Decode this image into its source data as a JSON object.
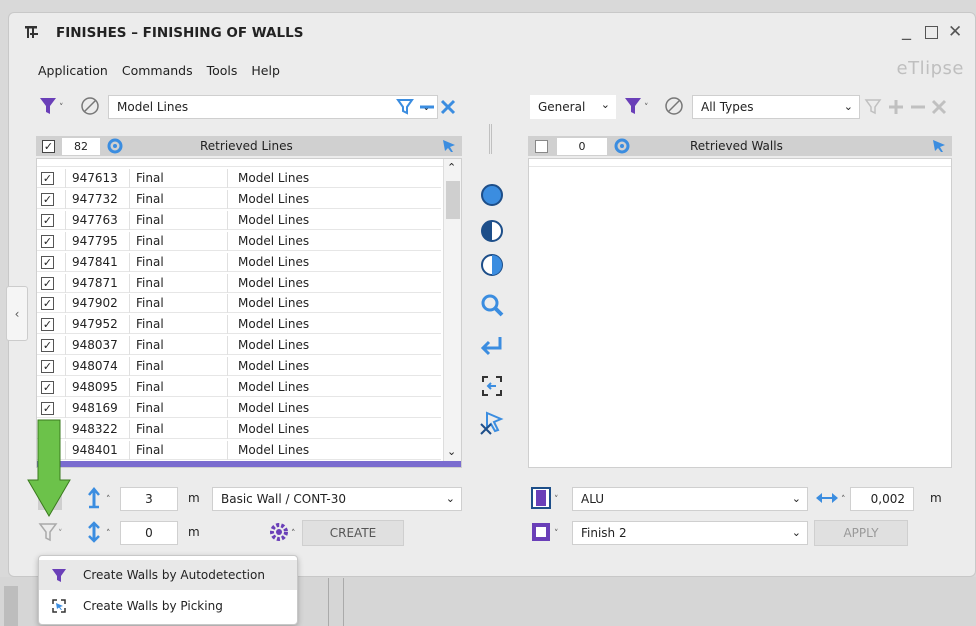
{
  "window": {
    "title": "FINISHES – FINISHING OF WALLS",
    "brand": "eTlipse"
  },
  "menu": [
    "Application",
    "Commands",
    "Tools",
    "Help"
  ],
  "left": {
    "category": "Model Lines",
    "count": "82",
    "header": "Retrieved Lines",
    "rows": [
      {
        "id": "947613",
        "status": "Final",
        "type": "Model Lines"
      },
      {
        "id": "947732",
        "status": "Final",
        "type": "Model Lines"
      },
      {
        "id": "947763",
        "status": "Final",
        "type": "Model Lines"
      },
      {
        "id": "947795",
        "status": "Final",
        "type": "Model Lines"
      },
      {
        "id": "947841",
        "status": "Final",
        "type": "Model Lines"
      },
      {
        "id": "947871",
        "status": "Final",
        "type": "Model Lines"
      },
      {
        "id": "947902",
        "status": "Final",
        "type": "Model Lines"
      },
      {
        "id": "947952",
        "status": "Final",
        "type": "Model Lines"
      },
      {
        "id": "948037",
        "status": "Final",
        "type": "Model Lines"
      },
      {
        "id": "948074",
        "status": "Final",
        "type": "Model Lines"
      },
      {
        "id": "948095",
        "status": "Final",
        "type": "Model Lines"
      },
      {
        "id": "948169",
        "status": "Final",
        "type": "Model Lines"
      },
      {
        "id": "948322",
        "status": "Final",
        "type": "Model Lines"
      },
      {
        "id": "948401",
        "status": "Final",
        "type": "Model Lines"
      }
    ],
    "height_value": "3",
    "height_unit": "m",
    "wall_type": "Basic Wall / CONT-30",
    "offset_value": "0",
    "offset_unit": "m",
    "create_label": "CREATE"
  },
  "right": {
    "mode": "General",
    "types": "All Types",
    "count": "0",
    "header": "Retrieved Walls",
    "material": "ALU",
    "thickness": "0,002",
    "thickness_unit": "m",
    "finish": "Finish 2",
    "apply_label": "APPLY"
  },
  "popup": {
    "items": [
      "Create Walls by Autodetection",
      "Create Walls by Picking"
    ]
  },
  "colors": {
    "accent": "#3b8de0",
    "purple": "#6a3fb8",
    "arrow": "#6cc24a"
  }
}
